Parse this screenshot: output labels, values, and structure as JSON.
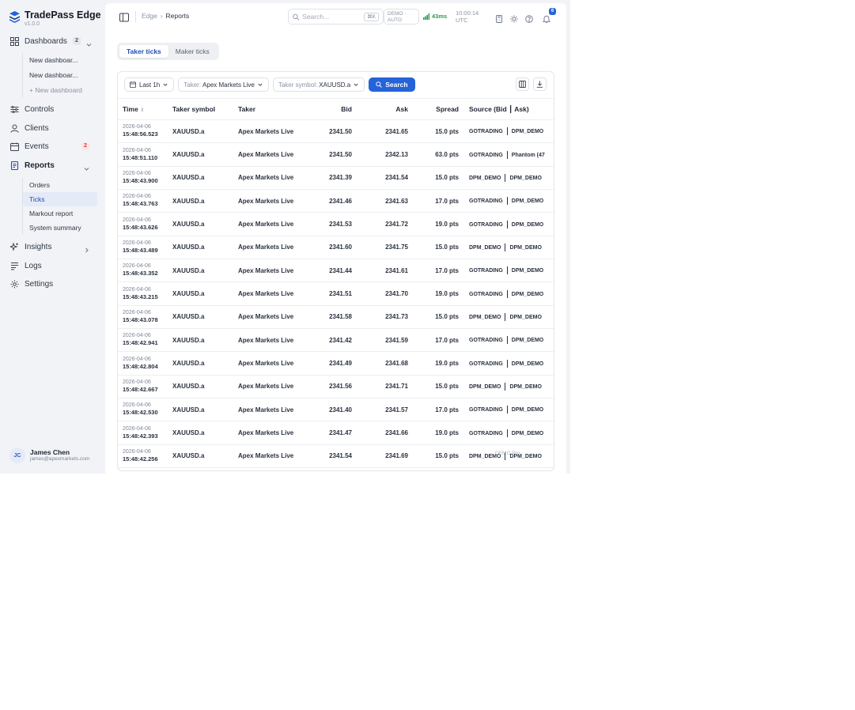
{
  "app": {
    "name": "TradePass Edge",
    "version": "v1.0.0"
  },
  "sidebar": {
    "dashboards": {
      "label": "Dashboards",
      "count": "2",
      "items": [
        "New dashboar...",
        "New dashboar..."
      ],
      "add_label": "+ New dashboard"
    },
    "controls": "Controls",
    "clients": "Clients",
    "events": {
      "label": "Events",
      "count": "2"
    },
    "reports": {
      "label": "Reports",
      "items": [
        "Orders",
        "Ticks",
        "Markout report",
        "System summary"
      ]
    },
    "insights": "Insights",
    "logs": "Logs",
    "settings": "Settings",
    "user": {
      "initials": "JC",
      "name": "James Chen",
      "email": "james@apexmarkets.com"
    }
  },
  "topbar": {
    "breadcrumb_root": "Edge",
    "breadcrumb_sep": "›",
    "breadcrumb_current": "Reports",
    "search_placeholder": "Search...",
    "search_shortcut": "⌘K",
    "mode_line1": "DEMO ·",
    "mode_line2": "AUTO",
    "latency": "43ms",
    "clock_time": "10:00:14",
    "clock_zone": "UTC",
    "notifications": "6"
  },
  "tabs": [
    "Taker ticks",
    "Maker ticks"
  ],
  "filters": {
    "range": "Last 1h",
    "taker_label": "Taker:",
    "taker_value": "Apex Markets Live",
    "symbol_label": "Taker symbol:",
    "symbol_value": "XAUUSD.a",
    "search_label": "Search"
  },
  "table": {
    "headers": {
      "time": "Time",
      "sort": "⇕",
      "symbol": "Taker symbol",
      "taker": "Taker",
      "bid": "Bid",
      "ask": "Ask",
      "spread": "Spread",
      "source": "Source (Bid ┃ Ask)"
    },
    "rows": [
      {
        "date": "2026-04-06",
        "time": "15:48:56.523",
        "symbol": "XAUUSD.a",
        "taker": "Apex Markets Live",
        "bid": "2341.50",
        "ask": "2341.65",
        "spread": "15.0 pts",
        "src_bid": "GOTRADING",
        "src_ask": "DPM_DEMO"
      },
      {
        "date": "2026-04-06",
        "time": "15:48:51.110",
        "symbol": "XAUUSD.a",
        "taker": "Apex Markets Live",
        "bid": "2341.50",
        "ask": "2342.13",
        "spread": "63.0 pts",
        "src_bid": "GOTRADING",
        "src_ask": "Phantom (47"
      },
      {
        "date": "2026-04-06",
        "time": "15:48:43.900",
        "symbol": "XAUUSD.a",
        "taker": "Apex Markets Live",
        "bid": "2341.39",
        "ask": "2341.54",
        "spread": "15.0 pts",
        "src_bid": "DPM_DEMO",
        "src_ask": "DPM_DEMO"
      },
      {
        "date": "2026-04-06",
        "time": "15:48:43.763",
        "symbol": "XAUUSD.a",
        "taker": "Apex Markets Live",
        "bid": "2341.46",
        "ask": "2341.63",
        "spread": "17.0 pts",
        "src_bid": "GOTRADING",
        "src_ask": "DPM_DEMO"
      },
      {
        "date": "2026-04-06",
        "time": "15:48:43.626",
        "symbol": "XAUUSD.a",
        "taker": "Apex Markets Live",
        "bid": "2341.53",
        "ask": "2341.72",
        "spread": "19.0 pts",
        "src_bid": "GOTRADING",
        "src_ask": "DPM_DEMO"
      },
      {
        "date": "2026-04-06",
        "time": "15:48:43.489",
        "symbol": "XAUUSD.a",
        "taker": "Apex Markets Live",
        "bid": "2341.60",
        "ask": "2341.75",
        "spread": "15.0 pts",
        "src_bid": "DPM_DEMO",
        "src_ask": "DPM_DEMO"
      },
      {
        "date": "2026-04-06",
        "time": "15:48:43.352",
        "symbol": "XAUUSD.a",
        "taker": "Apex Markets Live",
        "bid": "2341.44",
        "ask": "2341.61",
        "spread": "17.0 pts",
        "src_bid": "GOTRADING",
        "src_ask": "DPM_DEMO"
      },
      {
        "date": "2026-04-06",
        "time": "15:48:43.215",
        "symbol": "XAUUSD.a",
        "taker": "Apex Markets Live",
        "bid": "2341.51",
        "ask": "2341.70",
        "spread": "19.0 pts",
        "src_bid": "GOTRADING",
        "src_ask": "DPM_DEMO"
      },
      {
        "date": "2026-04-06",
        "time": "15:48:43.078",
        "symbol": "XAUUSD.a",
        "taker": "Apex Markets Live",
        "bid": "2341.58",
        "ask": "2341.73",
        "spread": "15.0 pts",
        "src_bid": "DPM_DEMO",
        "src_ask": "DPM_DEMO"
      },
      {
        "date": "2026-04-06",
        "time": "15:48:42.941",
        "symbol": "XAUUSD.a",
        "taker": "Apex Markets Live",
        "bid": "2341.42",
        "ask": "2341.59",
        "spread": "17.0 pts",
        "src_bid": "GOTRADING",
        "src_ask": "DPM_DEMO"
      },
      {
        "date": "2026-04-06",
        "time": "15:48:42.804",
        "symbol": "XAUUSD.a",
        "taker": "Apex Markets Live",
        "bid": "2341.49",
        "ask": "2341.68",
        "spread": "19.0 pts",
        "src_bid": "GOTRADING",
        "src_ask": "DPM_DEMO"
      },
      {
        "date": "2026-04-06",
        "time": "15:48:42.667",
        "symbol": "XAUUSD.a",
        "taker": "Apex Markets Live",
        "bid": "2341.56",
        "ask": "2341.71",
        "spread": "15.0 pts",
        "src_bid": "DPM_DEMO",
        "src_ask": "DPM_DEMO"
      },
      {
        "date": "2026-04-06",
        "time": "15:48:42.530",
        "symbol": "XAUUSD.a",
        "taker": "Apex Markets Live",
        "bid": "2341.40",
        "ask": "2341.57",
        "spread": "17.0 pts",
        "src_bid": "GOTRADING",
        "src_ask": "DPM_DEMO"
      },
      {
        "date": "2026-04-06",
        "time": "15:48:42.393",
        "symbol": "XAUUSD.a",
        "taker": "Apex Markets Live",
        "bid": "2341.47",
        "ask": "2341.66",
        "spread": "19.0 pts",
        "src_bid": "GOTRADING",
        "src_ask": "DPM_DEMO"
      },
      {
        "date": "2026-04-06",
        "time": "15:48:42.256",
        "symbol": "XAUUSD.a",
        "taker": "Apex Markets Live",
        "bid": "2341.54",
        "ask": "2341.69",
        "spread": "15.0 pts",
        "src_bid": "DPM_DEMO",
        "src_ask": "DPM_DEMO"
      }
    ]
  },
  "watermark": "DEMO  Pro",
  "colors": {
    "accent": "#2563d9",
    "active_bg": "#e4ebf7",
    "badge_red": "#d43b3b",
    "latency_green": "#2f9a4a",
    "app_bg": "#f1f3f6"
  }
}
